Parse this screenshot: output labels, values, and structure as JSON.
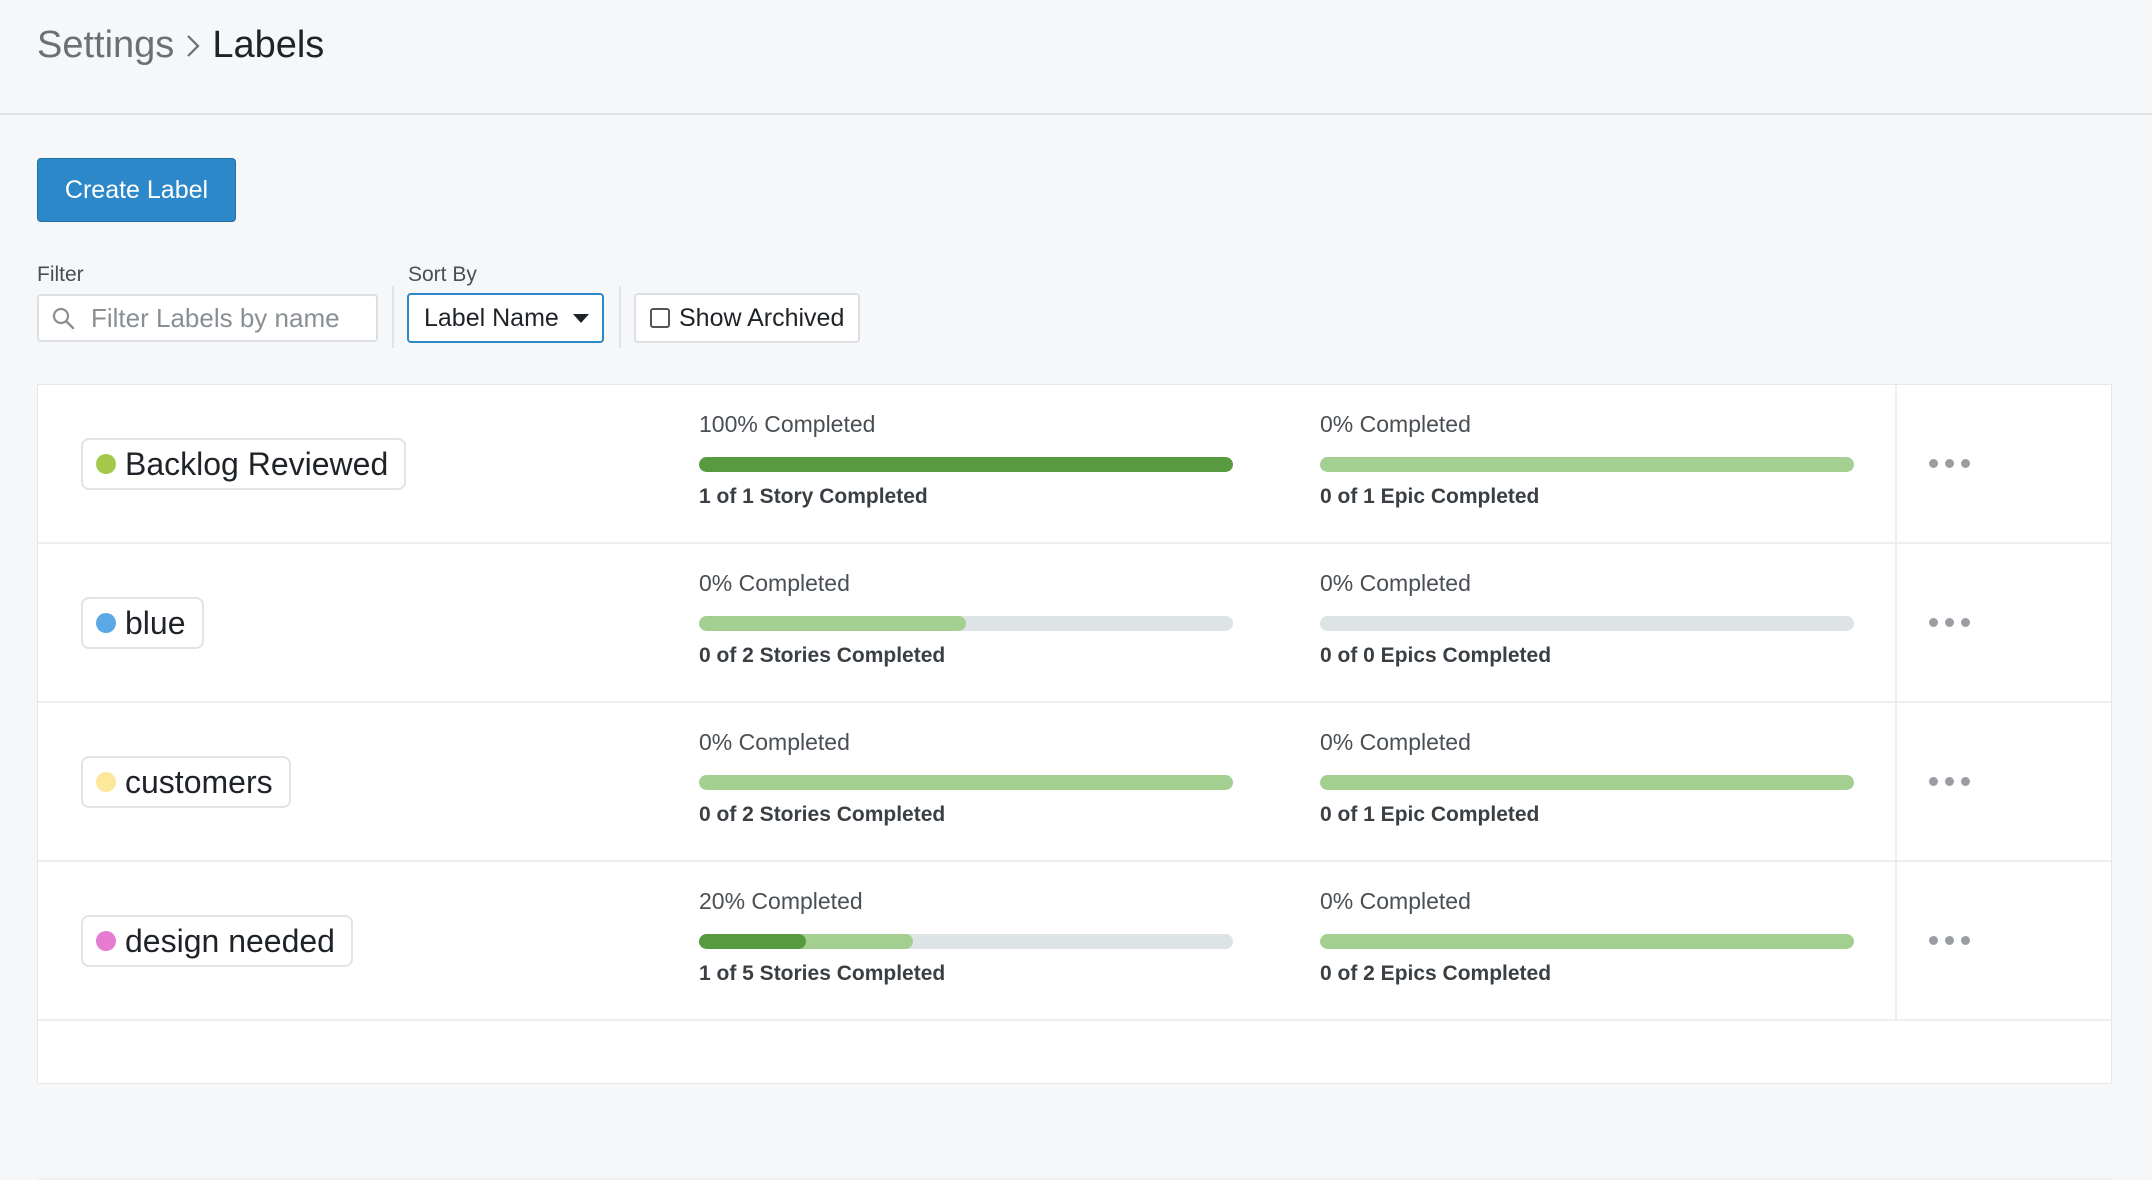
{
  "breadcrumb": {
    "parent": "Settings",
    "current": "Labels"
  },
  "toolbar": {
    "create_label": "Create Label",
    "filter_label": "Filter",
    "filter_placeholder": "Filter Labels by name",
    "sort_label": "Sort By",
    "sort_value": "Label Name",
    "show_archived": "Show Archived",
    "show_archived_checked": false
  },
  "colors": {
    "accent": "#2c88c9",
    "progress_complete": "#579a40",
    "progress_started": "#a3cf91",
    "progress_track": "#dee3e5"
  },
  "labels": [
    {
      "name": "Backlog Reviewed",
      "color": "#a3c94b",
      "stories": {
        "percent_text": "100% Completed",
        "summary": "1 of 1 Story Completed",
        "completed_fraction": 1.0,
        "started_fraction": 1.0
      },
      "epics": {
        "percent_text": "0% Completed",
        "summary": "0 of 1 Epic Completed",
        "completed_fraction": 0.0,
        "started_fraction": 1.0
      }
    },
    {
      "name": "blue",
      "color": "#5aa9e6",
      "stories": {
        "percent_text": "0% Completed",
        "summary": "0 of 2 Stories Completed",
        "completed_fraction": 0.0,
        "started_fraction": 0.5
      },
      "epics": {
        "percent_text": "0% Completed",
        "summary": "0 of 0 Epics Completed",
        "completed_fraction": 0.0,
        "started_fraction": 0.0
      }
    },
    {
      "name": "customers",
      "color": "#fde79a",
      "stories": {
        "percent_text": "0% Completed",
        "summary": "0 of 2 Stories Completed",
        "completed_fraction": 0.0,
        "started_fraction": 1.0
      },
      "epics": {
        "percent_text": "0% Completed",
        "summary": "0 of 1 Epic Completed",
        "completed_fraction": 0.0,
        "started_fraction": 1.0
      }
    },
    {
      "name": "design needed",
      "color": "#e67bd0",
      "stories": {
        "percent_text": "20% Completed",
        "summary": "1 of 5 Stories Completed",
        "completed_fraction": 0.2,
        "started_fraction": 0.4
      },
      "epics": {
        "percent_text": "0% Completed",
        "summary": "0 of 2 Epics Completed",
        "completed_fraction": 0.0,
        "started_fraction": 1.0
      }
    }
  ]
}
